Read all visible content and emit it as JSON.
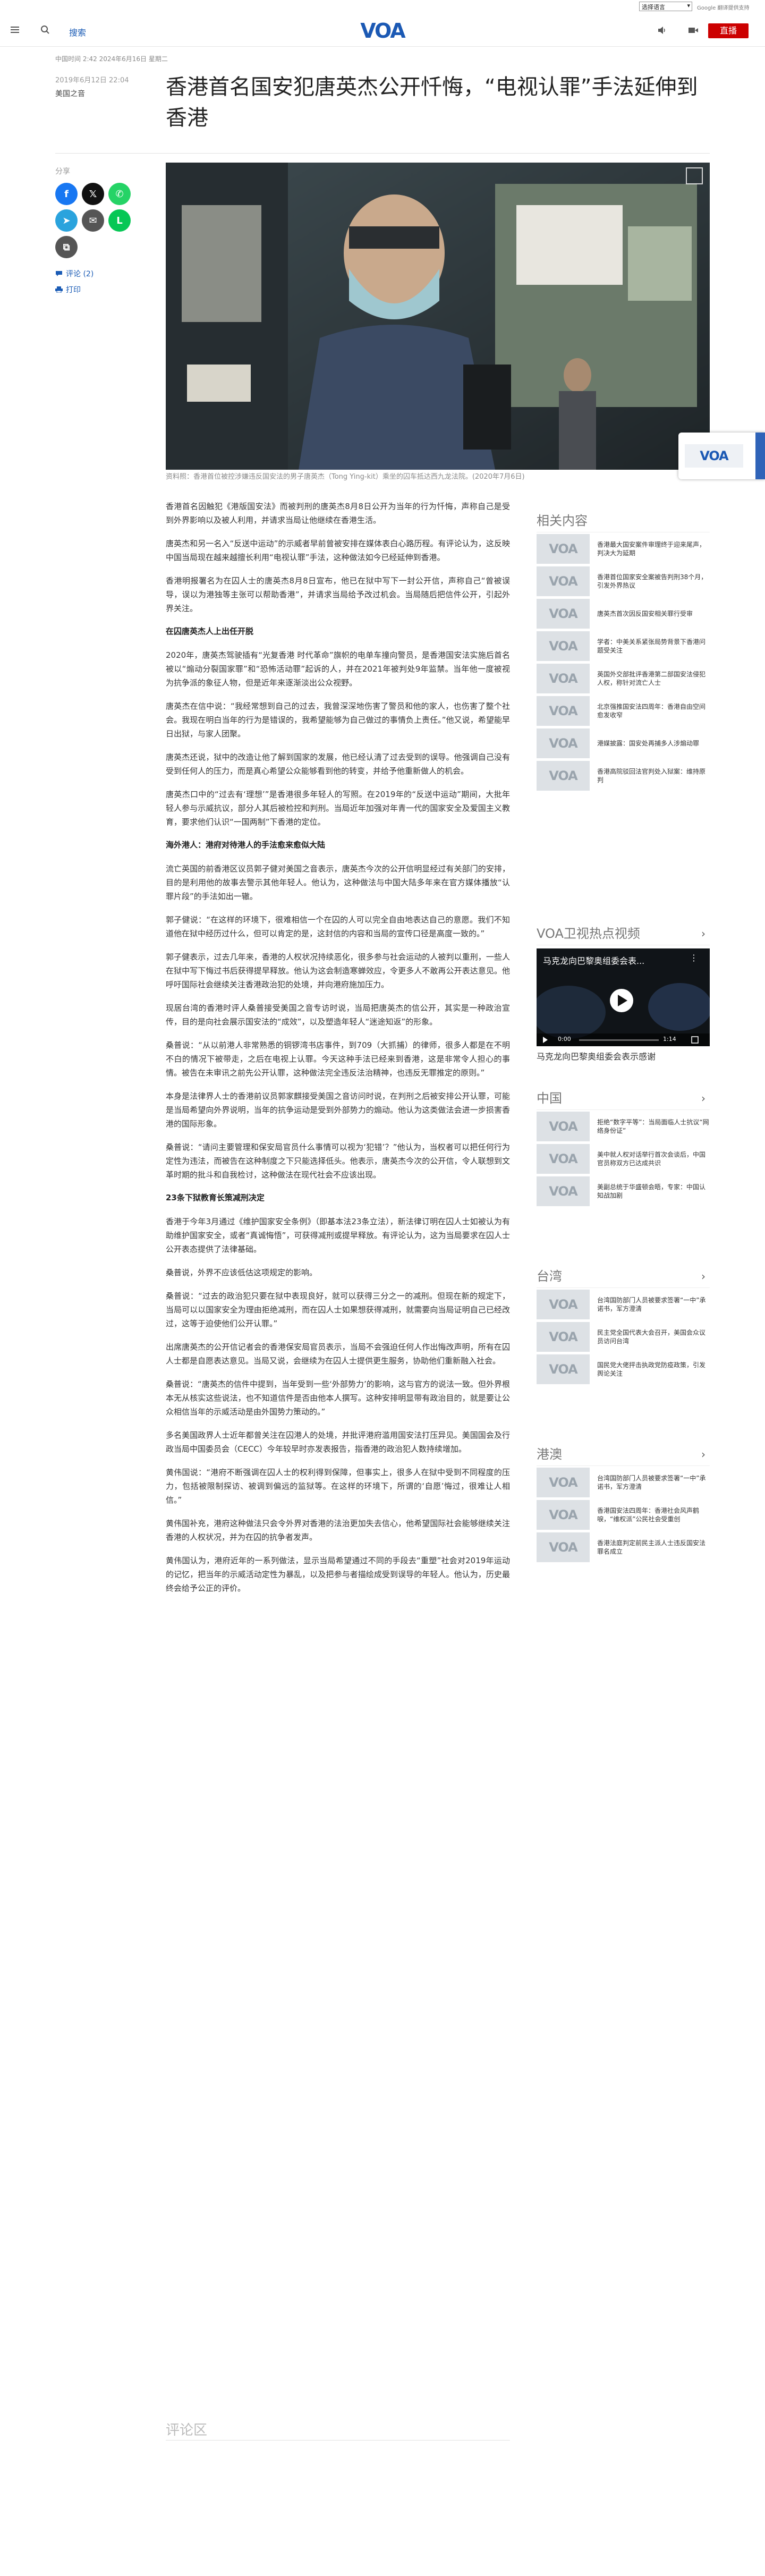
{
  "util": {
    "language": "选择语言",
    "translate": "Google 翻译提供支持"
  },
  "header": {
    "nav_search": "搜索",
    "logo": "VOA",
    "live_label": "直播"
  },
  "article": {
    "meta_line": "中国时间 2:42 2024年6月16日 星期二",
    "date": "2019年6月12日 22:04",
    "author": "美国之音",
    "title": "香港首名国安犯唐英杰公开忏悔，“电视认罪”手法延伸到香港",
    "caption": "资料照：香港首位被控涉嫌违反国安法的男子唐英杰（Tong Ying-kit）乘坐的囚车抵达西九龙法院。(2020年7月6日)",
    "body": [
      {
        "type": "p",
        "text": "香港首名因触犯《港版国安法》而被判刑的唐英杰8月8日公开为当年的行为忏悔，声称自己是受到外界影响以及被人利用，并请求当局让他继续在香港生活。"
      },
      {
        "type": "p",
        "text": "唐英杰和另一名入“反送中运动”的示威者早前曾被安排在媒体表白心路历程。有评论认为，这反映中国当局现在越来越擅长利用“电视认罪”手法，这种做法如今已经延伸到香港。"
      },
      {
        "type": "p",
        "text": "香港明报署名为在囚人士的唐英杰8月8日宣布，他已在狱中写下一封公开信，声称自己“曾被误导，误以为港独等主张可以帮助香港”，并请求当局给予改过机会。当局随后把信件公开，引起外界关注。"
      },
      {
        "type": "h",
        "text": "在囚唐英杰人上出任开脱"
      },
      {
        "type": "p",
        "text": "2020年，唐英杰驾驶插有“光复香港 时代革命”旗帜的电单车撞向警员，是香港国安法实施后首名被以“煽动分裂国家罪”和“恐怖活动罪”起诉的人，并在2021年被判处9年监禁。当年他一度被视为抗争派的象征人物，但是近年来逐渐淡出公众视野。"
      },
      {
        "type": "p",
        "text": "唐英杰在信中说：“我经常想到自己的过去，我曾深深地伤害了警员和他的家人，也伤害了整个社会。我现在明白当年的行为是错误的，我希望能够为自己做过的事情负上责任。”他又说，希望能早日出狱，与家人团聚。"
      },
      {
        "type": "p",
        "text": "唐英杰还说，狱中的改造让他了解到国家的发展，他已经认清了过去受到的误导。他强调自己没有受到任何人的压力，而是真心希望公众能够看到他的转变，并给予他重新做人的机会。"
      },
      {
        "type": "p",
        "text": "唐英杰口中的“过去有‘理想’”是香港很多年轻人的写照。在2019年的“反送中运动”期间，大批年轻人参与示威抗议，部分人其后被检控和判刑。当局近年加强对年青一代的国家安全及爱国主义教育，要求他们认识“一国两制”下香港的定位。"
      },
      {
        "type": "h",
        "text": "海外港人：港府对待港人的手法愈来愈似大陆"
      },
      {
        "type": "p",
        "text": "流亡英国的前香港区议员郭子健对美国之音表示，唐英杰今次的公开信明显经过有关部门的安排，目的是利用他的故事去警示其他年轻人。他认为，这种做法与中国大陆多年来在官方媒体播放“认罪片段”的手法如出一辙。"
      },
      {
        "type": "p",
        "text": "郭子健说：“在这样的环境下，很难相信一个在囚的人可以完全自由地表达自己的意愿。我们不知道他在狱中经历过什么，但可以肯定的是，这封信的内容和当局的宣传口径是高度一致的。”"
      },
      {
        "type": "p",
        "text": "郭子健表示，过去几年来，香港的人权状况持续恶化，很多参与社会运动的人被判以重刑，一些人在狱中写下悔过书后获得提早释放。他认为这会制造寒蝉效应，令更多人不敢再公开表达意见。他呼吁国际社会继续关注香港政治犯的处境，并向港府施加压力。"
      },
      {
        "type": "p",
        "text": "现居台湾的香港时评人桑普接受美国之音专访时说，当局把唐英杰的信公开，其实是一种政治宣传，目的是向社会展示国安法的“成效”，以及塑造年轻人“迷途知返”的形象。"
      },
      {
        "type": "p",
        "text": "桑普说：“从以前港人非常熟悉的铜锣湾书店事件，到709（大抓捕）的律师，很多人都是在不明不白的情况下被带走，之后在电视上认罪。今天这种手法已经来到香港，这是非常令人担心的事情。被告在未审讯之前先公开认罪，这种做法完全违反法治精神，也违反无罪推定的原则。”"
      },
      {
        "type": "p",
        "text": "本身是法律界人士的香港前议员郭家麒接受美国之音访问时说，在判刑之后被安排公开认罪，可能是当局希望向外界说明，当年的抗争运动是受到外部势力的煽动。他认为这类做法会进一步损害香港的国际形象。"
      },
      {
        "type": "p",
        "text": "桑普说：“请问主要管理和保安局官员什么事情可以视为‘犯错’？”他认为，当权者可以把任何行为定性为违法，而被告在这种制度之下只能选择低头。他表示，唐英杰今次的公开信，令人联想到文革时期的批斗和自我检讨，这种做法在现代社会不应该出现。"
      },
      {
        "type": "h",
        "text": "23条下狱教育长策减刑决定"
      },
      {
        "type": "p",
        "text": "香港于今年3月通过《维护国家安全条例》（即基本法23条立法），新法律订明在囚人士如被认为有助维护国家安全，或者“真诚悔悟”，可获得减刑或提早释放。有评论认为，这为当局要求在囚人士公开表态提供了法律基础。"
      },
      {
        "type": "p",
        "text": "桑普说，外界不应该低估这项规定的影响。"
      },
      {
        "type": "p",
        "text": "桑普说：“过去的政治犯只要在狱中表现良好，就可以获得三分之一的减刑。但现在新的规定下，当局可以以国家安全为理由拒绝减刑，而在囚人士如果想获得减刑，就需要向当局证明自己已经改过，这等于迫使他们公开认罪。”"
      },
      {
        "type": "p",
        "text": "出席唐英杰的公开信记者会的香港保安局官员表示，当局不会强迫任何人作出悔改声明，所有在囚人士都是自愿表达意见。当局又说，会继续为在囚人士提供更生服务，协助他们重新融入社会。"
      },
      {
        "type": "p",
        "text": "桑普说：“唐英杰的信件中提到，当年受到一些‘外部势力’的影响，这与官方的说法一致。但外界根本无从核实这些说法，也不知道信件是否由他本人撰写。这种安排明显带有政治目的，就是要让公众相信当年的示威活动是由外国势力策动的。”"
      },
      {
        "type": "p",
        "text": "多名美国政界人士近年都曾关注在囚港人的处境，并批评港府滥用国安法打压异见。美国国会及行政当局中国委员会（CECC）今年较早时亦发表报告，指香港的政治犯人数持续增加。"
      },
      {
        "type": "p",
        "text": "黄伟国说：“港府不断强调在囚人士的权利得到保障，但事实上，很多人在狱中受到不同程度的压力，包括被限制探访、被调到偏远的监狱等。在这样的环境下，所谓的‘自愿’悔过，很难让人相信。”"
      },
      {
        "type": "p",
        "text": "黄伟国补充，港府这种做法只会令外界对香港的法治更加失去信心，他希望国际社会能够继续关注香港的人权状况，并为在囚的抗争者发声。"
      },
      {
        "type": "p",
        "text": "黄伟国认为，港府近年的一系列做法，显示当局希望通过不同的手段去“重塑”社会对2019年运动的记忆，把当年的示威活动定性为暴乱，以及把参与者描绘成受到误导的年轻人。他认为，历史最终会给予公正的评价。"
      }
    ],
    "comments_heading": "评论区"
  },
  "share": {
    "label": "分享",
    "buttons": [
      {
        "name": "facebook",
        "glyph": "f",
        "color": "#1877f2"
      },
      {
        "name": "x",
        "glyph": "𝕏",
        "color": "#111111"
      },
      {
        "name": "whatsapp",
        "glyph": "✆",
        "color": "#25d366"
      },
      {
        "name": "telegram",
        "glyph": "➤",
        "color": "#2aa3dd"
      },
      {
        "name": "email",
        "glyph": "✉",
        "color": "#555555"
      },
      {
        "name": "line",
        "glyph": "L",
        "color": "#06c755"
      },
      {
        "name": "copy",
        "glyph": "⧉",
        "color": "#555555"
      }
    ],
    "comments_link": "评论 (2)",
    "print_link": "打印"
  },
  "rail": {
    "related": {
      "heading": "相关内容",
      "items": [
        "香港最大国安案件审理终于迎来尾声，判决大为延期",
        "香港首位国家安全案被告判刑38个月，引发外界热议",
        "唐英杰首次因反国安相关罪行受审",
        "学者：中美关系紧张局势背景下香港问题受关注",
        "英国外交部批评香港第二部国安法侵犯人权，称针对流亡人士",
        "北京强推国安法四周年：香港自由空间愈发收窄",
        "港媒披露：国安处再捕多人涉煽动罪",
        "香港高院驳回法官判处入狱案：维持原判"
      ]
    },
    "video": {
      "heading": "VOA卫视热点视频",
      "overlay_title": "马克龙向巴黎奥组委会表...",
      "time": "0:00",
      "duration": "1:14",
      "title": "马克龙向巴黎奥组委会表示感谢"
    },
    "china": {
      "heading": "中国",
      "items": [
        "拒绝“数字平等”：当局面临人士抗议“网络身份证”",
        "美中就人权对话举行首次会谈后，中国官员称双方已达成共识",
        "美副总统于华盛顿会晤，专家：中国认知战加剧"
      ]
    },
    "taiwan": {
      "heading": "台湾",
      "items": [
        "台湾国防部门人员被要求签署“一中”承诺书，军方澄清",
        "民主党全国代表大会召开，美国会众议员访问台湾",
        "国民党大佬抨击执政党防疫政策，引发舆论关注"
      ]
    },
    "hongkong": {
      "heading": "港澳",
      "items": [
        "台湾国防部门人员被要求签署“一中”承诺书，军方澄清",
        "香港国安法四周年：香港社会风声鹤唳，“维权派”公民社会受重创",
        "香港法庭判定前民主派人士违反国安法罪名成立"
      ]
    }
  }
}
